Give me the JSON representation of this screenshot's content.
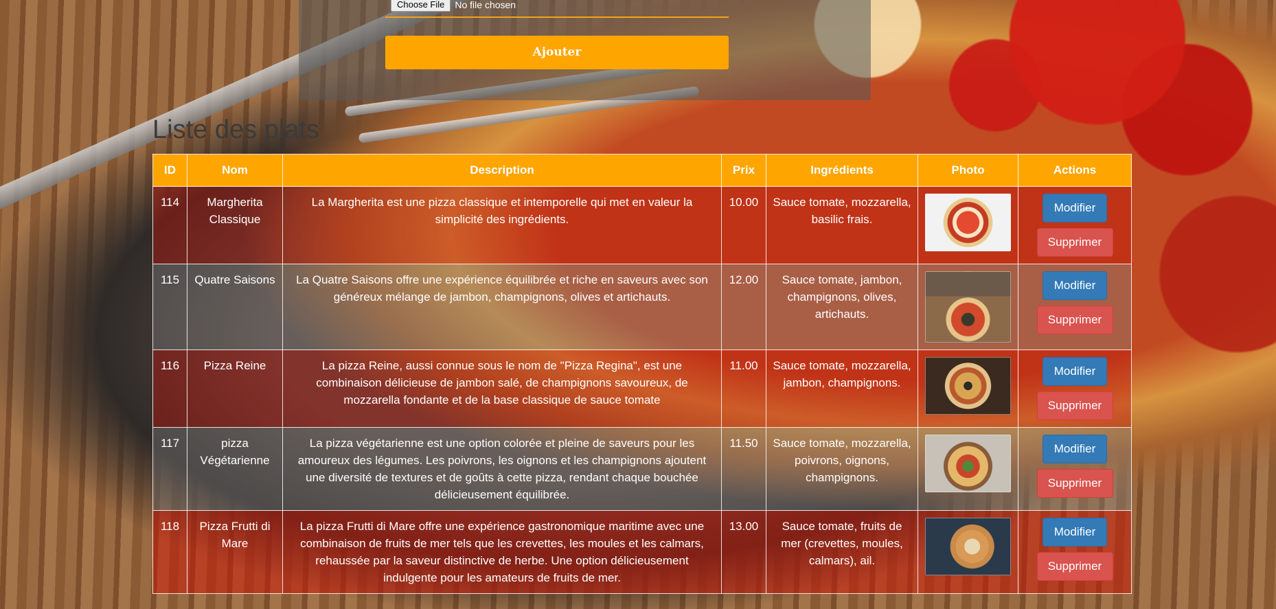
{
  "form": {
    "file_button": "Choose File",
    "file_status": "No file chosen",
    "submit_label": "Ajouter"
  },
  "list": {
    "title": "Liste des plats",
    "columns": [
      "ID",
      "Nom",
      "Description",
      "Prix",
      "Ingrédients",
      "Photo",
      "Actions"
    ],
    "rows": [
      {
        "id": "114",
        "name": "Margherita Classique",
        "description": "La Margherita est une pizza classique et intemporelle qui met en valeur la simplicité des ingrédients.",
        "price": "10.00",
        "ingredients": "Sauce tomate, mozzarella, basilic frais.",
        "photo_icon": "margherita-pizza-photo"
      },
      {
        "id": "115",
        "name": "Quatre Saisons",
        "description": "La Quatre Saisons offre une expérience équilibrée et riche en saveurs avec son généreux mélange de jambon, champignons, olives et artichauts.",
        "price": "12.00",
        "ingredients": "Sauce tomate, jambon, champignons, olives, artichauts.",
        "photo_icon": "quatre-saisons-pizza-photo"
      },
      {
        "id": "116",
        "name": "Pizza Reine",
        "description": "La pizza Reine, aussi connue sous le nom de \"Pizza Regina\", est une combinaison délicieuse de jambon salé, de champignons savoureux, de mozzarella fondante et de la base classique de sauce tomate",
        "price": "11.00",
        "ingredients": "Sauce tomate, mozzarella, jambon, champignons.",
        "photo_icon": "reine-pizza-photo"
      },
      {
        "id": "117",
        "name": "pizza Végétarienne",
        "description": "La pizza végétarienne est une option colorée et pleine de saveurs pour les amoureux des légumes. Les poivrons, les oignons et les champignons ajoutent une diversité de textures et de goûts à cette pizza, rendant chaque bouchée délicieusement équilibrée.",
        "price": "11.50",
        "ingredients": "Sauce tomate, mozzarella, poivrons, oignons, champignons.",
        "photo_icon": "vegetarienne-pizza-photo"
      },
      {
        "id": "118",
        "name": "Pizza Frutti di Mare",
        "description": "La pizza Frutti di Mare offre une expérience gastronomique maritime avec une combinaison de fruits de mer tels que les crevettes, les moules et les calmars, rehaussée par la saveur distinctive de herbe. Une option délicieusement indulgente pour les amateurs de fruits de mer.",
        "price": "13.00",
        "ingredients": "Sauce tomate, fruits de mer (crevettes, moules, calmars), ail.",
        "photo_icon": "frutti-di-mare-pizza-photo"
      }
    ],
    "edit_label": "Modifier",
    "delete_label": "Supprimer"
  },
  "colors": {
    "accent": "#ffa500",
    "edit_button": "#337ab7",
    "delete_button": "#d9534f"
  }
}
